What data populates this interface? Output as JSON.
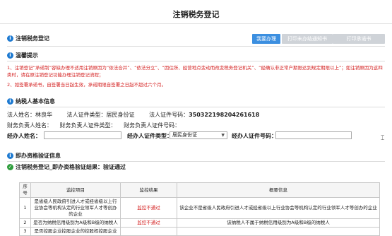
{
  "page": {
    "title": "注销税务登记"
  },
  "header_section": {
    "title": "注销税务登记",
    "buttons": {
      "apply": "我要办理",
      "print_notice": "打印未办结通知书",
      "print_commitment": "打印承诺书"
    }
  },
  "tips": {
    "title": "温馨提示",
    "line1": "1、注销登记“承诺制”容缺办理不适用注销原因为“依法合并”、“依法分立”、“因住所、经营地点变动而改变税务登记机关”、“经确认非正常户期限达到规定期限以上”；如注销原因为这四类时，请在原注销登记功能办理注销登记流程；",
    "line2": "2、如签署承诺书，自签署当日起生效，承诺期限自签署之日起不超过六个月。"
  },
  "taxpayer": {
    "title": "纳税人基本信息",
    "legal_name_label": "法人姓名：",
    "legal_name": "林良华",
    "legal_id_type_label": "法人证件类型：",
    "legal_id_type": "居民身份证",
    "legal_id_no_label": "法人证件号码：",
    "legal_id_no": "350322198204261618",
    "finance_name_label": "财务负责人姓名：",
    "finance_name": "",
    "finance_id_type_label": "财务负责人证件类型：",
    "finance_id_type": "",
    "finance_id_no_label": "财务负责人证件号码：",
    "finance_id_no": "",
    "agent_name_label": "经办人姓名：",
    "agent_name_value": "",
    "agent_id_type_label": "经办人证件类型：",
    "agent_id_type_value": "居民身份证",
    "agent_id_no_label": "经办人证件号码：",
    "agent_id_no_value": ""
  },
  "verification": {
    "title": "即办资格验证信息",
    "result_text": "注销税务登记_即办资格验证结果：验证通过",
    "columns": [
      "序号",
      "监控项目",
      "监控结果",
      "概要信息"
    ],
    "rows": [
      {
        "no": "1",
        "item": "是省级人民政府引进人才或经省级以上行业协会等机构认定的行业领军人才等创办的企业",
        "result": "监控不通过",
        "summary": "该企业不是省级人民政府引进人才或经省级以上行业协会等机构认定的行业领军人才等创办的企业"
      },
      {
        "no": "2",
        "item": "是否为纳税信用级别为A级和B级的纳税人",
        "result": "监控不通过",
        "summary": "该纳税人不属于纳税信用级别为A级和B级的纳税人"
      },
      {
        "no": "3",
        "item": "是否控股企业控股企业的控股权控股企业",
        "result": "",
        "summary": ""
      }
    ]
  },
  "colors": {
    "primary": "#3c8fe0",
    "danger": "#d42020",
    "success": "#2e9d3c",
    "info": "#1e7ad1"
  }
}
